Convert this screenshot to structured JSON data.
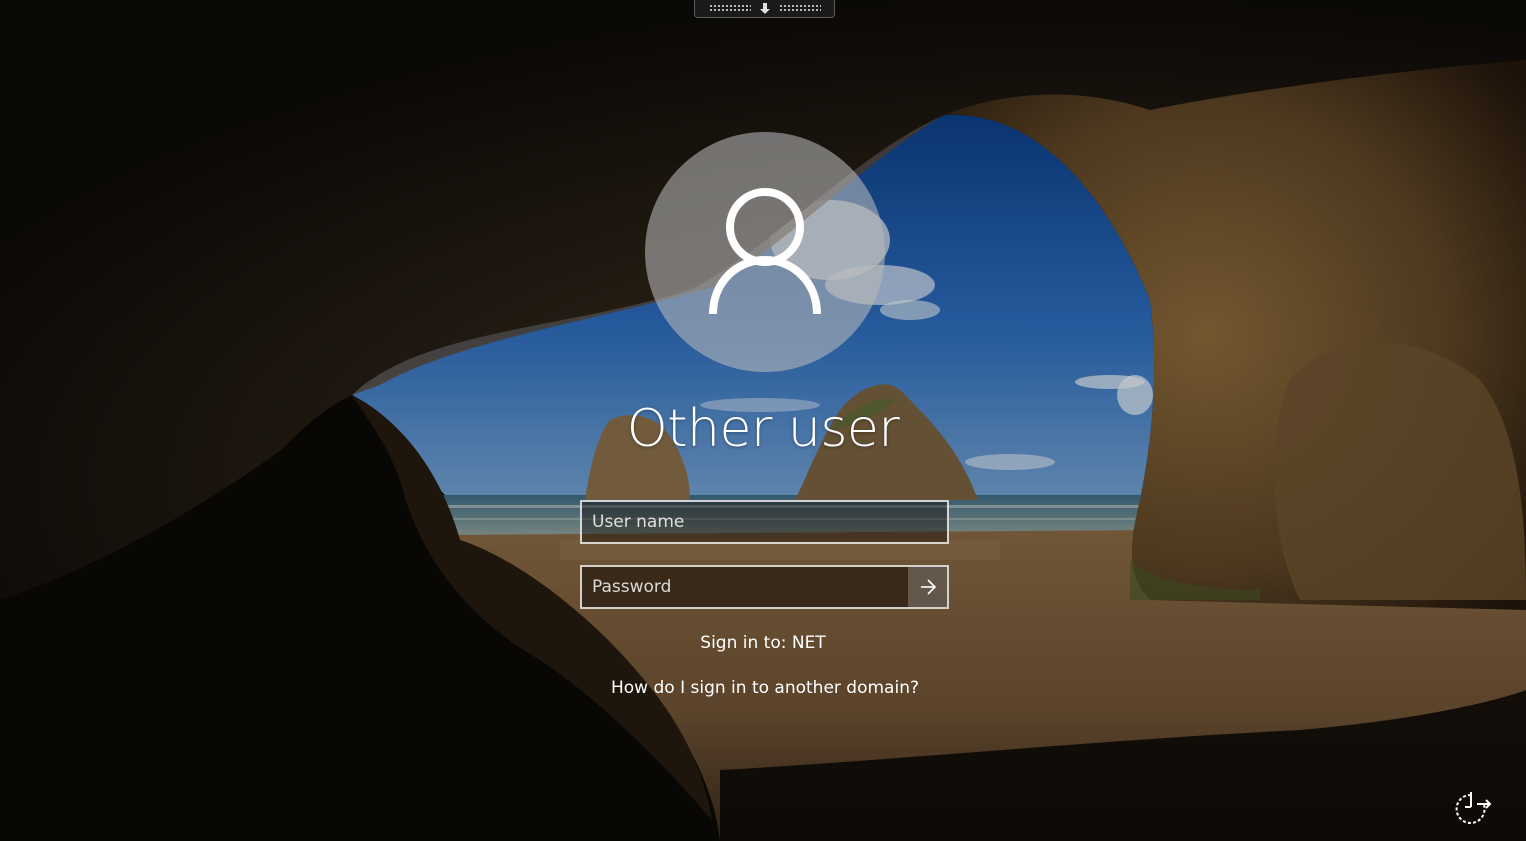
{
  "screen": "Windows sign-in",
  "user": {
    "display_name": "Other user",
    "avatar_icon": "person-icon"
  },
  "form": {
    "username_placeholder": "User name",
    "username_value": "",
    "password_placeholder": "Password",
    "password_value": "",
    "submit_icon": "arrow-right-icon"
  },
  "sign_in_to": "Sign in to: NET",
  "other_domain_link": "How do I sign in to another domain?",
  "connection_bar": {
    "pin_icon": "pin-down-icon"
  },
  "ease_of_access": {
    "icon": "ease-of-access-icon"
  },
  "colors": {
    "text": "#ffffff",
    "field_border": "#d8d8d8",
    "avatar_circle": "#b9b9b9"
  }
}
